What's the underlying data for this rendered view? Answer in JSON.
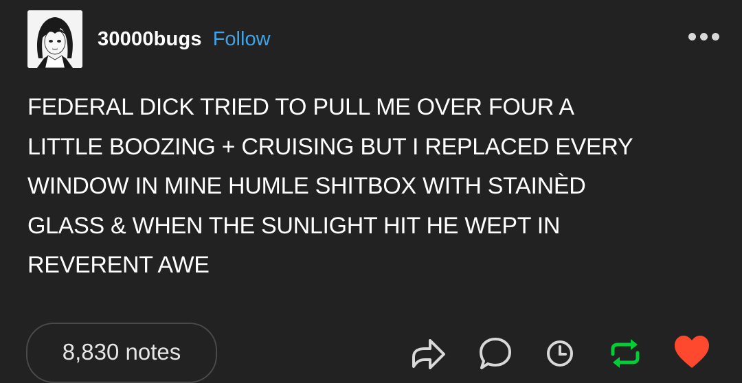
{
  "header": {
    "username": "30000bugs",
    "follow_label": "Follow",
    "avatar_icon": "avatar-drawing-girl",
    "more_icon": "more-dots-icon"
  },
  "post": {
    "lines": [
      "FEDERAL DICK TRIED TO PULL ME OVER FOUR A",
      "LITTLE BOOZING + CRUISING BUT I REPLACED EVERY",
      "WINDOW IN MINE HUMLE SHITBOX WITH STAINÈD",
      "GLASS & WHEN THE SUNLIGHT HIT HE WEPT IN",
      "REVERENT AWE"
    ]
  },
  "footer": {
    "notes_label": "8,830 notes",
    "actions": [
      "share-icon",
      "comment-icon",
      "schedule-icon",
      "reblog-icon",
      "like-icon"
    ]
  },
  "colors": {
    "background": "#222222",
    "text": "#ffffff",
    "follow": "#3fa4e8",
    "reblog": "#01cf35",
    "like": "#ff492f"
  }
}
